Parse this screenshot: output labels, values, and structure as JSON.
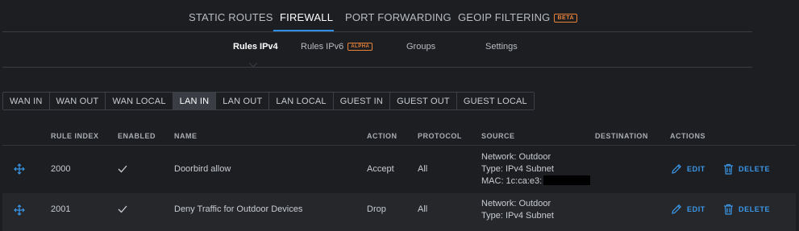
{
  "top_tabs": {
    "static_routes": "STATIC ROUTES",
    "firewall": "FIREWALL",
    "port_forwarding": "PORT FORWARDING",
    "geoip_filtering": "GEOIP FILTERING",
    "beta_badge": "BETA"
  },
  "sub_tabs": {
    "rules_ipv4": "Rules IPv4",
    "rules_ipv6": "Rules IPv6",
    "alpha_badge": "ALPHA",
    "groups": "Groups",
    "settings": "Settings"
  },
  "chains": [
    "WAN IN",
    "WAN OUT",
    "WAN LOCAL",
    "LAN IN",
    "LAN OUT",
    "LAN LOCAL",
    "GUEST IN",
    "GUEST OUT",
    "GUEST LOCAL"
  ],
  "active_chain": "LAN IN",
  "table": {
    "headers": {
      "rule_index": "RULE INDEX",
      "enabled": "ENABLED",
      "name": "NAME",
      "action": "ACTION",
      "protocol": "PROTOCOL",
      "source": "SOURCE",
      "destination": "DESTINATION",
      "actions": "ACTIONS"
    },
    "rows": [
      {
        "rule_index": "2000",
        "enabled": true,
        "name": "Doorbird allow",
        "action": "Accept",
        "protocol": "All",
        "source": [
          "Network: Outdoor",
          "Type: IPv4 Subnet",
          "MAC: 1c:ca:e3:"
        ],
        "destination": "",
        "edit": "EDIT",
        "delete": "DELETE"
      },
      {
        "rule_index": "2001",
        "enabled": true,
        "name": "Deny Traffic for Outdoor Devices",
        "action": "Drop",
        "protocol": "All",
        "source": [
          "Network: Outdoor",
          "Type: IPv4 Subnet"
        ],
        "destination": "",
        "edit": "EDIT",
        "delete": "DELETE"
      }
    ]
  },
  "colors": {
    "accent": "#2f8fe5",
    "badge": "#e8823a",
    "background": "#1c1e21",
    "row_alt": "#25272b",
    "active_chain": "#3a3e44"
  }
}
